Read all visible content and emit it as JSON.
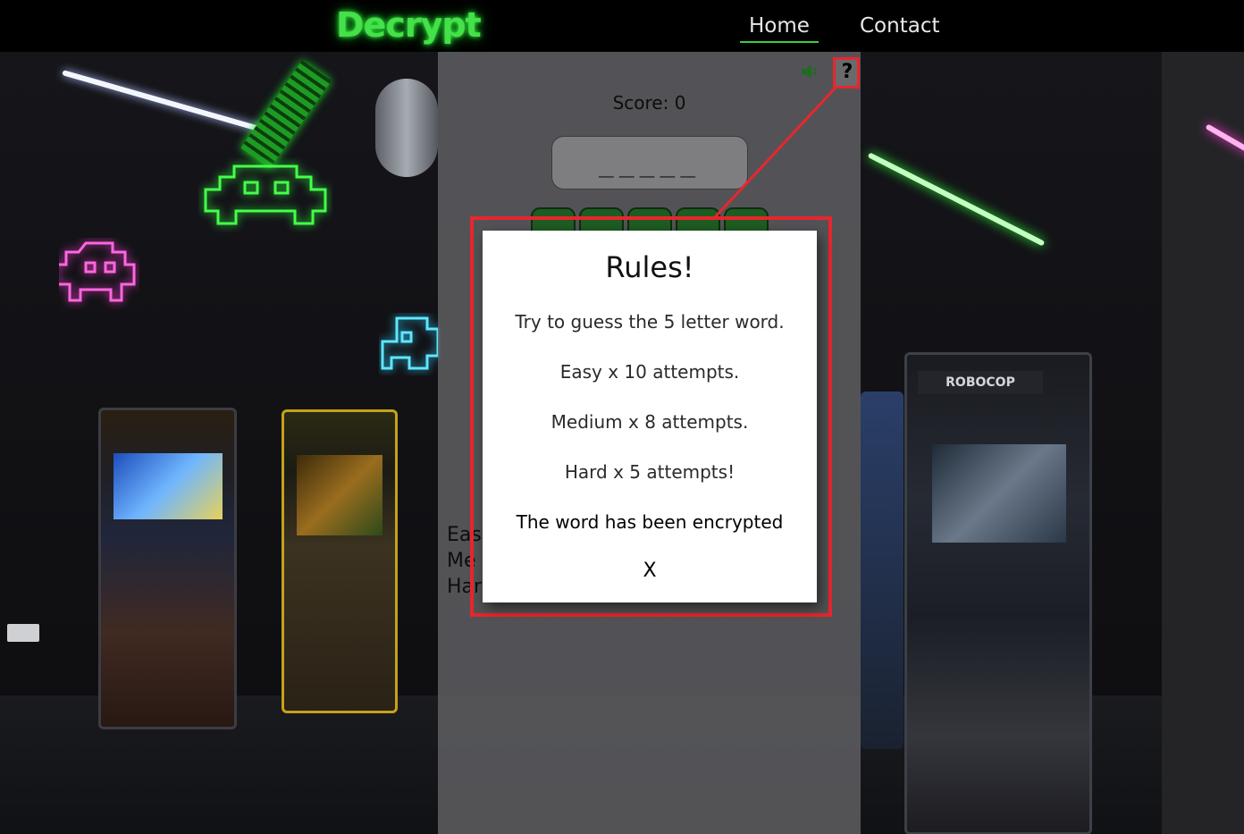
{
  "header": {
    "logo": "Decrypt",
    "nav": [
      {
        "label": "Home",
        "active": true
      },
      {
        "label": "Contact",
        "active": false
      }
    ]
  },
  "background": {
    "robocop_marquee": "ROBOCOP"
  },
  "game": {
    "score_text": "Score: 0",
    "word_display": "_____",
    "sound_icon": "speaker-icon",
    "help_icon": "question-icon",
    "help_label": "?",
    "difficulty_labels": [
      "Eas",
      "Me",
      "Har"
    ]
  },
  "rules_modal": {
    "title": "Rules!",
    "lines": [
      "Try to guess the 5 letter word.",
      "Easy x 10 attempts.",
      "Medium x 8 attempts.",
      "Hard x 5 attempts!",
      "The word has been encrypted"
    ],
    "close_label": "X"
  },
  "colors": {
    "logo_green": "#45e04a",
    "nav_underline": "#3ad13f",
    "highlight_red": "#e8262d",
    "key_green": "#1f5c22"
  }
}
